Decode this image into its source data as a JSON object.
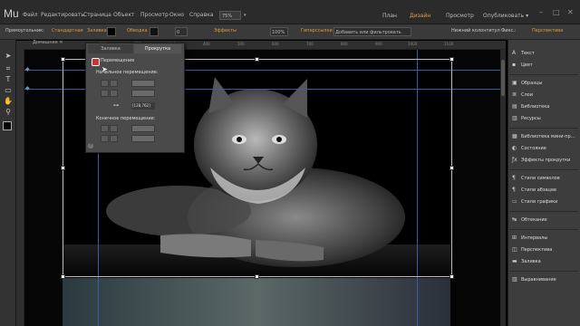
{
  "app": {
    "logo": "Mu"
  },
  "menu": [
    "Файл",
    "Редактировать",
    "Страница",
    "Объект",
    "Просмотр",
    "Окно",
    "Справка"
  ],
  "zoom": "75%",
  "view_modes": [
    "План",
    "Дизайн",
    "Просмотр"
  ],
  "publish_label": "Опубликовать ▾",
  "window_controls": [
    "–",
    "□",
    "✕"
  ],
  "control_bar": {
    "label": "Прямоугольник:",
    "link_standard": "Стандартная",
    "fill_label": "Заливка",
    "stroke_label": "Обводка",
    "stroke_value": "0",
    "effects_label": "Эффекты",
    "opacity_value": "100%",
    "hyperlinks": "Гиперссылки",
    "add_filter": "Добавить или фильтровать",
    "footer_check": "Нижний колонтитул",
    "fix_label": "Фикс.:",
    "perspective": "Перспектива"
  },
  "doc_tab": "Домашняя ✕",
  "ruler_marks": [
    "100",
    "200",
    "300",
    "400",
    "500",
    "600",
    "700",
    "800",
    "900",
    "1000",
    "1100"
  ],
  "scroll_popup": {
    "tabs": [
      "Заливка",
      "Прокрутка"
    ],
    "active_tab": "Прокрутка",
    "movement_label": "Перемещение",
    "start_label": "Начальное перемещение:",
    "end_label": "Конечное перемещение:",
    "start_value": "[128,762]",
    "help": "?"
  },
  "right_panel": [
    {
      "icon": "A",
      "label": "Текст"
    },
    {
      "icon": "▪",
      "label": "Цвет"
    },
    {
      "icon": "▣",
      "label": "Образцы"
    },
    {
      "icon": "≣",
      "label": "Слои"
    },
    {
      "icon": "▤",
      "label": "Библиотека"
    },
    {
      "icon": "▥",
      "label": "Ресурсы"
    },
    {
      "icon": "▦",
      "label": "Библиотека мини-пр..."
    },
    {
      "icon": "◐",
      "label": "Состояние"
    },
    {
      "icon": "ƒx",
      "label": "Эффекты прокрутки"
    },
    {
      "icon": "¶",
      "label": "Стили символов"
    },
    {
      "icon": "¶",
      "label": "Стили абзацев"
    },
    {
      "icon": "▭",
      "label": "Стили графики"
    },
    {
      "icon": "↹",
      "label": "Обтекание"
    },
    {
      "icon": "⊞",
      "label": "Интервалы"
    },
    {
      "icon": "◫",
      "label": "Перспектива"
    },
    {
      "icon": "▬",
      "label": "Заливка"
    },
    {
      "icon": "▥",
      "label": "Выравнивание"
    }
  ],
  "colors": {
    "accent": "#e09a3c",
    "guide": "#3c5da8",
    "bg_dark": "#2b2b2b"
  }
}
